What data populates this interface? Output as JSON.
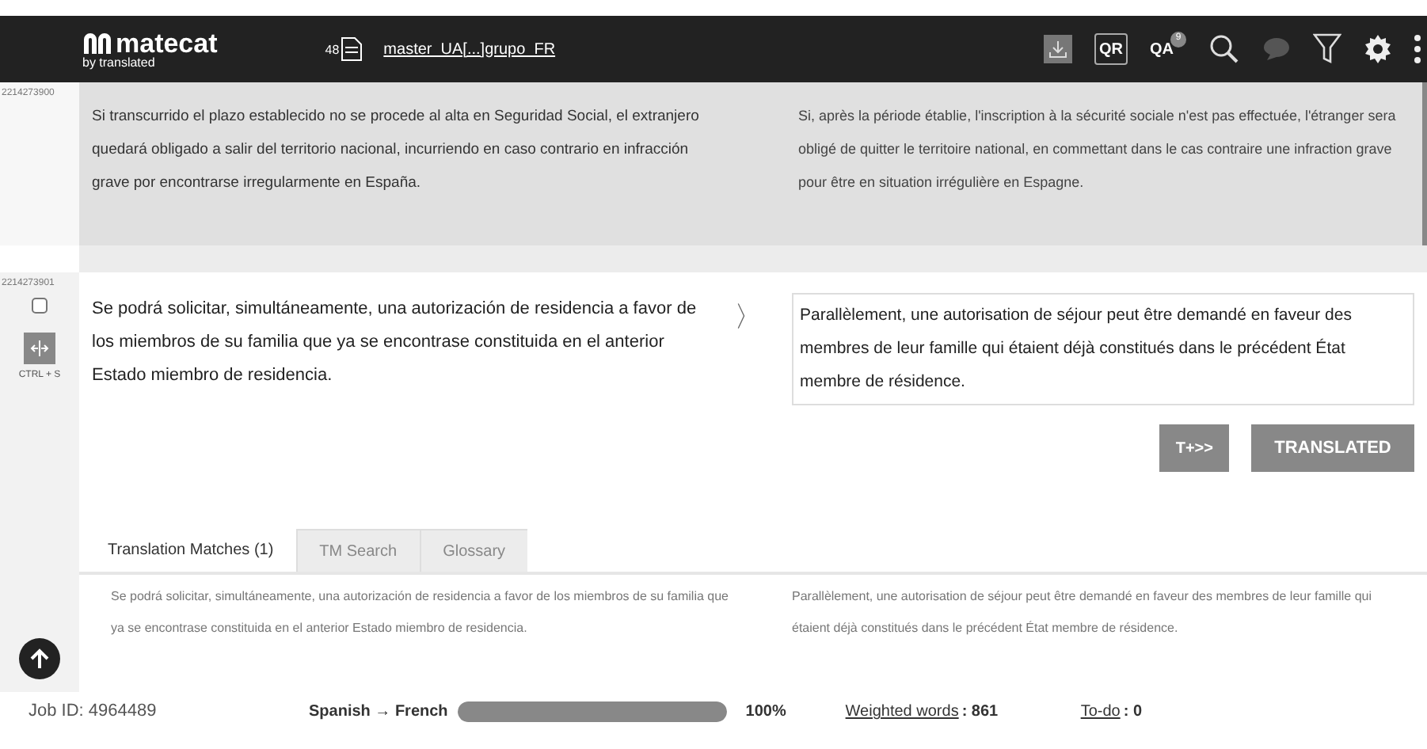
{
  "header": {
    "logo": "matecat",
    "logo_sub": "by translated",
    "file_count": "48",
    "project_name": "master_UA[...]grupo_FR",
    "tools": [
      {
        "kind": "download",
        "active": true
      },
      {
        "kind": "qr",
        "label": "QR"
      },
      {
        "kind": "qa",
        "label": "QA",
        "badge": "9"
      },
      {
        "kind": "search"
      },
      {
        "kind": "comment"
      },
      {
        "kind": "filter"
      },
      {
        "kind": "settings"
      },
      {
        "kind": "more"
      }
    ]
  },
  "segments": [
    {
      "id": "2214273900",
      "source": "Si transcurrido el plazo establecido no se procede al alta en Seguridad Social, el extranjero quedará obligado a salir del territorio nacional, incurriendo en caso contrario en infracción grave por encontrarse irregularmente en España.",
      "target": "Si, après la période établie, l'inscription à la sécurité sociale n'est pas effectuée, l'étranger sera obligé de quitter le territoire national, en commettant dans le cas contraire une infraction grave pour être en situation irrégulière en Espagne.",
      "editing": false
    },
    {
      "id": "2214273901",
      "checked": false,
      "shortcut": "CTRL + S",
      "source": "Se podrá solicitar, simultáneamente, una autorización de residencia a favor de los miembros de su familia que ya se encontrase constituida en el anterior Estado miembro de residencia.",
      "arrow": "〉",
      "target": "Parallèlement, une autorisation de séjour peut être demandé en faveur des membres de leur famille qui étaient déjà constitués dans le précédent État membre de résidence.",
      "editing": true,
      "buttons": [
        "T+>>",
        "TRANSLATED"
      ]
    }
  ],
  "tabs": [
    {
      "label": "Translation Matches (1)",
      "selected": true
    },
    {
      "label": "TM Search",
      "selected": false
    },
    {
      "label": "Glossary",
      "selected": false
    }
  ],
  "match": {
    "source": "Se podrá solicitar, simultáneamente, una autorización de residencia a favor de los miembros de su familia que ya se encontrase constituida en el anterior Estado miembro de residencia.",
    "target": "Parallèlement, une autorisation de séjour peut être demandé en faveur des membres de leur famille qui étaient déjà constitués dans le précédent État membre de résidence."
  },
  "status_bar": {
    "job_id": "Job ID: 4964489",
    "languages": "Spanish → French",
    "progress": {
      "level": 1.0
    },
    "percent": "100%",
    "weighted_label": "Weighted words",
    "weighted_value": ": 861",
    "todo_label": "To-do",
    "todo_value": " : 0"
  }
}
